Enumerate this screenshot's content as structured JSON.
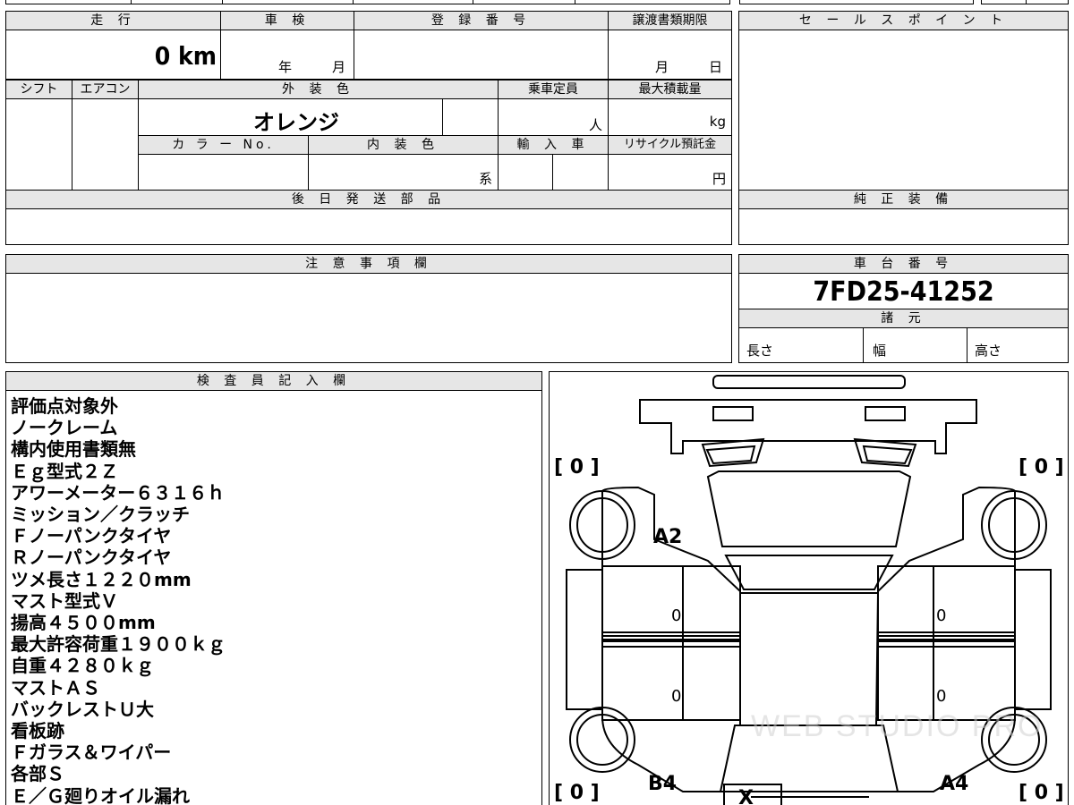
{
  "top_section": {
    "mileage_label": "走 行",
    "mileage_value": "0 km",
    "inspection_label": "車 検",
    "inspection_year": "年",
    "inspection_month": "月",
    "registration_label": "登 録 番 号",
    "transfer_label": "譲渡書類期限",
    "transfer_month": "月",
    "transfer_day": "日",
    "shift_label": "シフト",
    "ac_label": "エアコン",
    "exterior_color_label": "外 装 色",
    "exterior_color_value": "オレンジ",
    "capacity_label": "乗車定員",
    "capacity_unit": "人",
    "max_load_label": "最大積載量",
    "max_load_unit": "kg",
    "color_no_label": "カ ラ ー No.",
    "interior_color_label": "内 装 色",
    "interior_unit": "系",
    "import_label": "輸 入 車",
    "recycle_label": "リサイクル預託金",
    "recycle_unit": "円",
    "later_parts_label": "後 日 発 送 部 品"
  },
  "sales_point_label": "セ ー ル ス ポ イ ン ト",
  "genuine_equipment_label": "純 正 装 備",
  "notes_label": "注 意 事 項 欄",
  "chassis": {
    "label": "車 台 番 号",
    "value": "7FD25-41252",
    "specs_label": "諸 元",
    "length_label": "長さ",
    "width_label": "幅",
    "height_label": "高さ"
  },
  "inspector": {
    "label": "検 査 員 記 入 欄",
    "lines": [
      "評価点対象外",
      "ノークレーム",
      "構内使用書類無",
      "Ｅｇ型式２Ｚ",
      "アワーメーター６３１６ｈ",
      "ミッション／クラッチ",
      "Ｆノーパンクタイヤ",
      "Ｒノーパンクタイヤ",
      "ツメ長さ１２２０mm",
      "マスト型式Ｖ",
      "揚高４５００mm",
      "最大許容荷重１９００ｋｇ",
      "自重４２８０ｋｇ",
      "マストＡＳ",
      "バックレストＵ大",
      "看板跡",
      "Ｆガラス＆ワイパー",
      "各部Ｓ",
      "Ｅ／Ｇ廻りオイル漏れ"
    ]
  },
  "diagram": {
    "tire_fl": "[ 0 ]",
    "tire_fr": "[ 0 ]",
    "tire_rl": "[ 0 ]",
    "tire_rr": "[ 0 ]",
    "mark_a2": "A2",
    "mark_b4": "B4",
    "mark_a4": "A4",
    "mark_x": "X",
    "side_l1": "0",
    "side_l2": "0",
    "side_r1": "0",
    "side_r2": "0",
    "watermark": "WEB STUDIO PRO"
  }
}
